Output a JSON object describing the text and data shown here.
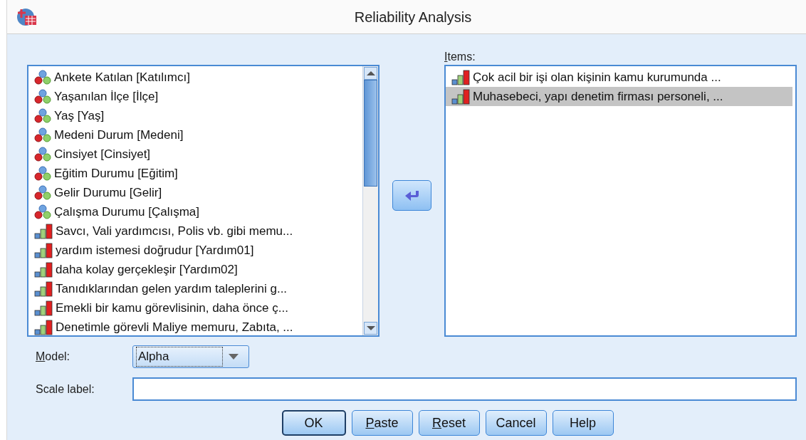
{
  "window": {
    "title": "Reliability Analysis"
  },
  "variables": [
    {
      "label": "Ankete Katılan [Katılımcı]",
      "kind": "nominal",
      "selected": false
    },
    {
      "label": "Yaşanılan İlçe [İlçe]",
      "kind": "nominal",
      "selected": false
    },
    {
      "label": "Yaş [Yaş]",
      "kind": "nominal",
      "selected": false
    },
    {
      "label": "Medeni Durum [Medeni]",
      "kind": "nominal",
      "selected": false
    },
    {
      "label": "Cinsiyet [Cinsiyet]",
      "kind": "nominal",
      "selected": false
    },
    {
      "label": "Eğitim Durumu [Eğitim]",
      "kind": "nominal",
      "selected": false
    },
    {
      "label": "Gelir Durumu [Gelir]",
      "kind": "nominal",
      "selected": false
    },
    {
      "label": "Çalışma Durumu [Çalışma]",
      "kind": "nominal",
      "selected": false
    },
    {
      "label": "Savcı, Vali yardımcısı, Polis vb. gibi memu...",
      "kind": "scale",
      "selected": false
    },
    {
      "label": "yardım istemesi doğrudur [Yardım01]",
      "kind": "scale",
      "selected": false
    },
    {
      "label": "daha kolay gerçekleşir [Yardım02]",
      "kind": "scale",
      "selected": false
    },
    {
      "label": "Tanıdıklarından gelen yardım taleplerini g...",
      "kind": "scale",
      "selected": false
    },
    {
      "label": "Emekli bir kamu görevlisinin, daha önce ç...",
      "kind": "scale",
      "selected": false
    },
    {
      "label": "Denetimle görevli Maliye memuru, Zabıta, ...",
      "kind": "scale",
      "selected": false
    }
  ],
  "items_label": {
    "text": "Items:",
    "mnemonic": true
  },
  "items": [
    {
      "label": "Çok acil bir işi olan kişinin kamu kurumunda ...",
      "kind": "scale",
      "selected": false
    },
    {
      "label": "Muhasebeci, yapı denetim firması personeli, ...",
      "kind": "scale",
      "selected": true
    }
  ],
  "model": {
    "label": "Model:",
    "mnemonic": true,
    "value": "Alpha"
  },
  "scale_label": {
    "label": "Scale label:"
  },
  "buttons": [
    {
      "label": "OK",
      "mnemonic": false,
      "default": true
    },
    {
      "label": "Paste",
      "mnemonic": true,
      "default": false
    },
    {
      "label": "Reset",
      "mnemonic": true,
      "default": false
    },
    {
      "label": "Cancel",
      "mnemonic": false,
      "default": false
    },
    {
      "label": "Help",
      "mnemonic": false,
      "default": false
    }
  ]
}
